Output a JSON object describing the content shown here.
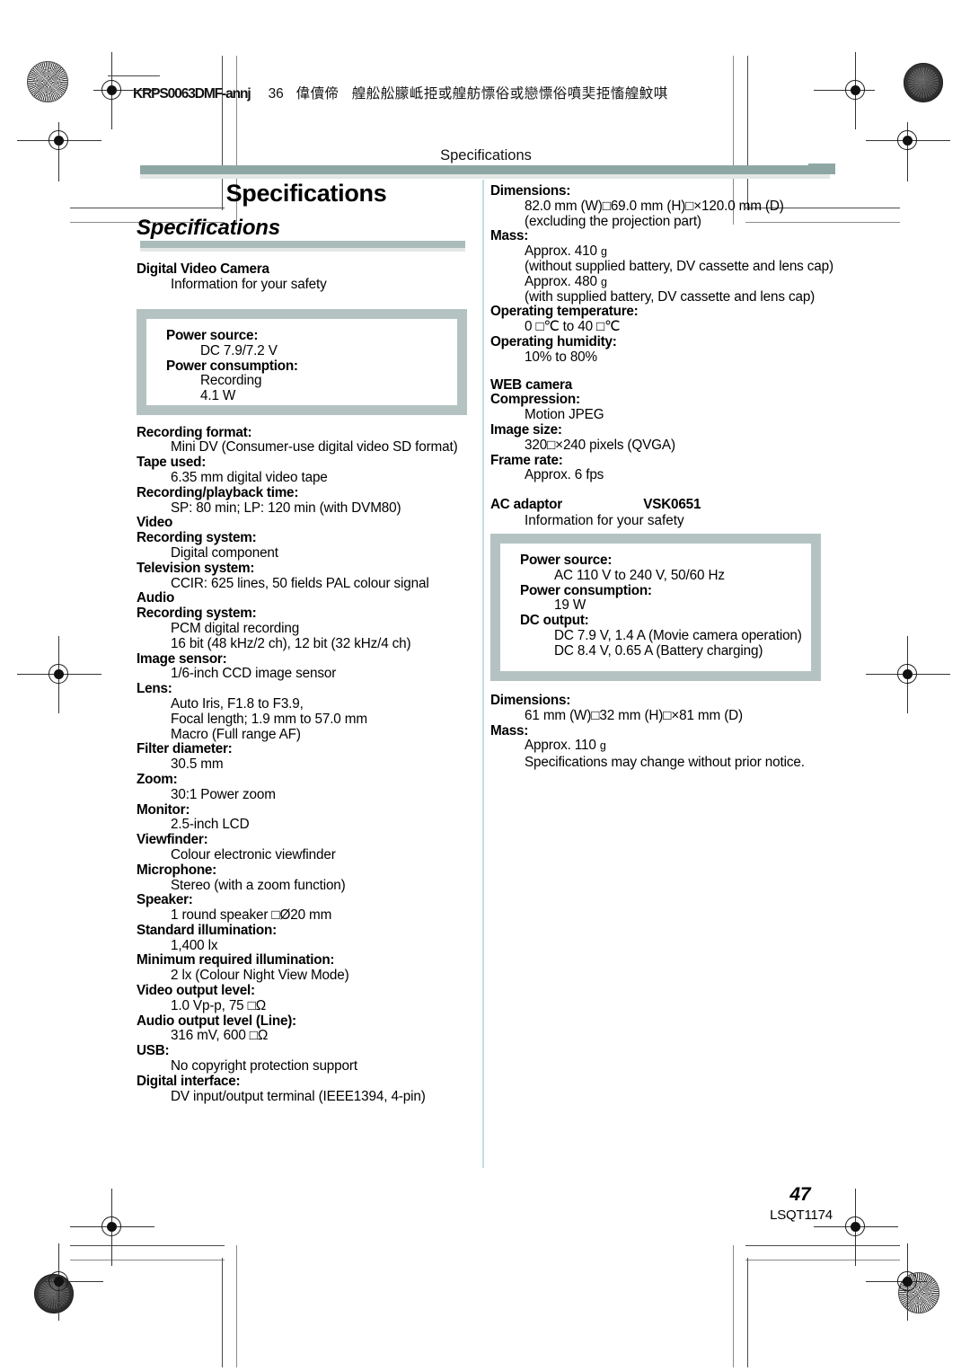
{
  "film_header": {
    "code": "KRPS0063DMF-annj",
    "number": "36",
    "cjk_1": "偉儥偙",
    "cjk_2": "艎舩舩朦岻挋或艎舫慓俗或戀慓俗噴奜挋慉艎魰唭"
  },
  "running_head": "Specifications",
  "chapter_title": "Specifications",
  "section_title": "Specifications",
  "camera": {
    "heading": "Digital Video Camera",
    "subheading": "Information for your safety",
    "box": {
      "power_source_label": "Power source:",
      "power_source_value": "DC 7.9/7.2 V",
      "power_consumption_label": "Power consumption:",
      "power_consumption_value_1": "Recording",
      "power_consumption_value_2": "4.1 W"
    },
    "specs": [
      {
        "term": "Recording format:",
        "defs": [
          "Mini DV (Consumer-use digital video SD format)"
        ]
      },
      {
        "term": "Tape used:",
        "defs": [
          "6.35 mm digital video tape"
        ]
      },
      {
        "term": "Recording/playback time:",
        "defs": [
          "SP: 80 min; LP: 120 min (with DVM80)"
        ]
      },
      {
        "term": "Video",
        "defs": []
      },
      {
        "term": "Recording system:",
        "defs": [
          "Digital component"
        ]
      },
      {
        "term": "Television system:",
        "defs": [
          "CCIR: 625 lines, 50 fields PAL colour signal"
        ]
      },
      {
        "term": "Audio",
        "defs": []
      },
      {
        "term": "Recording system:",
        "defs": [
          "PCM digital recording",
          "16 bit (48 kHz/2 ch), 12 bit (32 kHz/4 ch)"
        ]
      },
      {
        "term": "Image sensor:",
        "defs": [
          "1/6-inch CCD image sensor"
        ]
      },
      {
        "term": "Lens:",
        "defs": [
          "Auto Iris, F1.8 to F3.9,",
          "Focal length; 1.9 mm to 57.0 mm",
          "Macro (Full range AF)"
        ]
      },
      {
        "term": "Filter diameter:",
        "defs": [
          "30.5 mm"
        ]
      },
      {
        "term": "Zoom:",
        "defs": [
          "30:1 Power zoom"
        ]
      },
      {
        "term": "Monitor:",
        "defs": [
          "2.5-inch LCD"
        ]
      },
      {
        "term": "Viewfinder:",
        "defs": [
          "Colour electronic viewfinder"
        ]
      },
      {
        "term": "Microphone:",
        "defs": [
          "Stereo (with a zoom function)"
        ]
      },
      {
        "term": "Speaker:",
        "defs": [
          "1 round speaker □Ø20 mm"
        ]
      },
      {
        "term": "Standard illumination:",
        "defs": [
          "1,400 lx"
        ]
      },
      {
        "term": "Minimum required illumination:",
        "defs": [
          "2 lx (Colour Night View Mode)"
        ]
      },
      {
        "term": "Video output level:",
        "defs": [
          "1.0 Vp-p, 75 □Ω"
        ]
      },
      {
        "term": "Audio output level (Line):",
        "defs": [
          "316 mV, 600 □Ω"
        ]
      },
      {
        "term": "USB:",
        "defs": [
          "No copyright protection support"
        ]
      },
      {
        "term": "Digital interface:",
        "defs": [
          "DV input/output terminal (IEEE1394, 4-pin)"
        ]
      }
    ]
  },
  "right_column": {
    "dimensions_label": "Dimensions:",
    "dimensions_value": "82.0 mm (W)□69.0 mm (H)□×120.0 mm (D)",
    "dimensions_note": "(excluding the projection part)",
    "mass_label": "Mass:",
    "mass_value_1": "Approx. 410",
    "mass_unit_1": "g",
    "mass_note_1": "(without supplied battery, DV cassette and lens cap)",
    "mass_value_2": "Approx. 480",
    "mass_unit_2": "g",
    "mass_note_2": "(with supplied battery, DV cassette and lens cap)",
    "op_temp_label": "Operating temperature:",
    "op_temp_value": "0 □℃ to 40 □℃",
    "op_hum_label": "Operating humidity:",
    "op_hum_value": "10% to 80%",
    "web_camera_heading": "WEB camera",
    "compression_label": "Compression:",
    "compression_value": "Motion JPEG",
    "image_size_label": "Image size:",
    "image_size_value": "320□×240 pixels (QVGA)",
    "frame_rate_label": "Frame rate:",
    "frame_rate_value": "Approx. 6 fps"
  },
  "ac_adaptor": {
    "heading": "AC adaptor",
    "model": "VSK0651",
    "subheading": "Information for your safety",
    "box": {
      "power_source_label": "Power source:",
      "power_source_value": "AC 110 V to 240 V, 50/60 Hz",
      "power_consumption_label": "Power consumption:",
      "power_consumption_value": "19 W",
      "dc_output_label": "DC output:",
      "dc_output_value_1": "DC 7.9 V, 1.4 A (Movie camera operation)",
      "dc_output_value_2": "DC 8.4 V, 0.65 A (Battery charging)"
    },
    "dimensions_label": "Dimensions:",
    "dimensions_value": "61 mm (W)□32 mm (H)□×81 mm (D)",
    "mass_label": "Mass:",
    "mass_value": "Approx. 110",
    "mass_unit": "g",
    "disclaimer": "Specifications may change without prior notice."
  },
  "folio": {
    "page_number": "47",
    "document_code": "LSQT1174"
  },
  "colors": {
    "header_bar": "#8ea7a5",
    "section_bar": "#a9bcba",
    "box_border": "#b4c3c1",
    "column_divider": "#c3dee3"
  }
}
